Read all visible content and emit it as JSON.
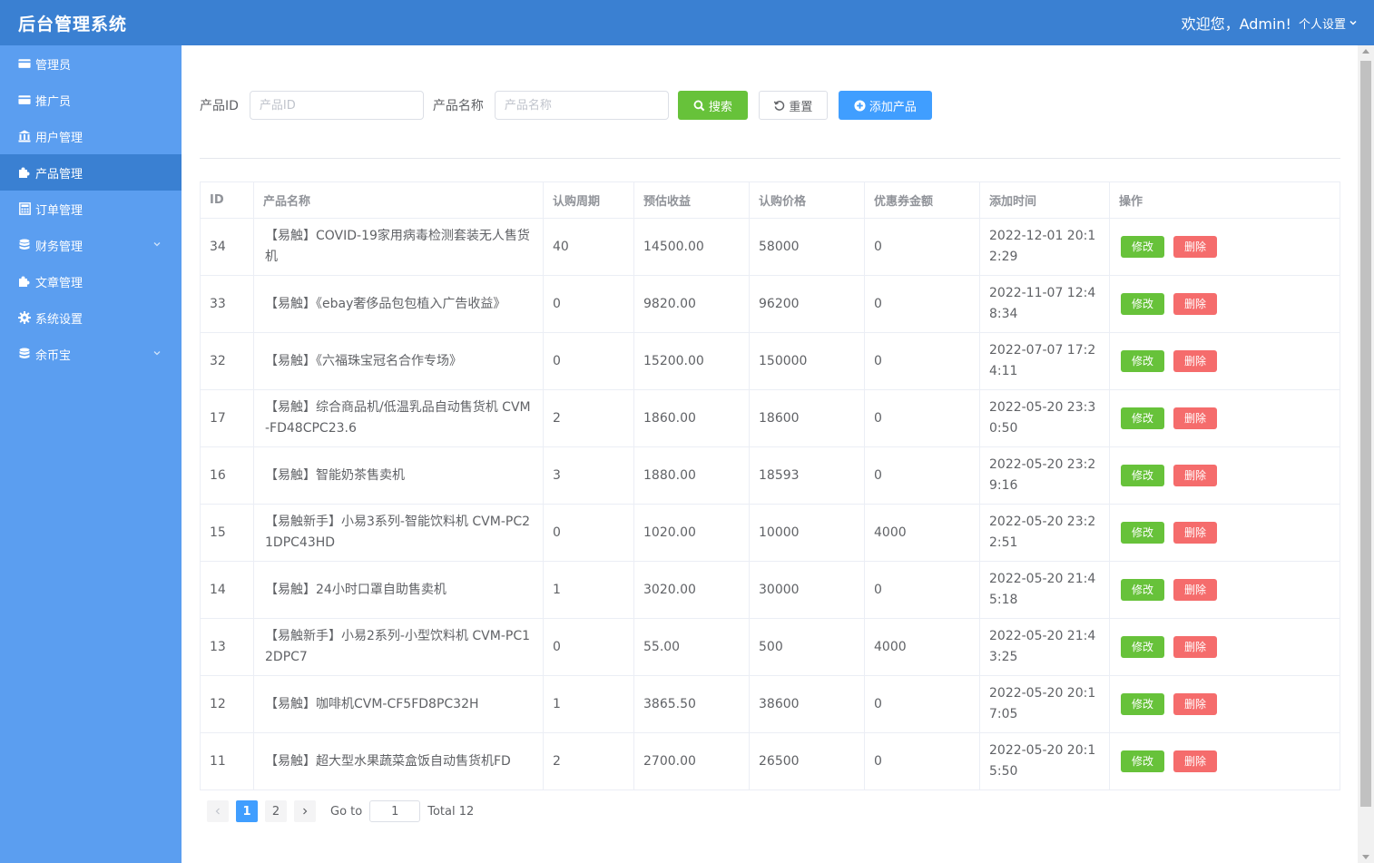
{
  "header": {
    "brand": "后台管理系统",
    "welcome": "欢迎您，Admin!",
    "settings": "个人设置"
  },
  "sidebar": {
    "items": [
      {
        "label": "管理员",
        "icon": "card-icon"
      },
      {
        "label": "推广员",
        "icon": "card-icon"
      },
      {
        "label": "用户管理",
        "icon": "bank-icon"
      },
      {
        "label": "产品管理",
        "icon": "puzzle-icon",
        "active": true
      },
      {
        "label": "订单管理",
        "icon": "calculator-icon"
      },
      {
        "label": "财务管理",
        "icon": "database-icon",
        "has_children": true
      },
      {
        "label": "文章管理",
        "icon": "puzzle-icon"
      },
      {
        "label": "系统设置",
        "icon": "gear-icon"
      },
      {
        "label": "余币宝",
        "icon": "database-icon",
        "has_children": true
      }
    ]
  },
  "filter": {
    "id_label": "产品ID",
    "id_placeholder": "产品ID",
    "name_label": "产品名称",
    "name_placeholder": "产品名称",
    "search_label": "搜索",
    "reset_label": "重置",
    "add_label": "添加产品"
  },
  "table": {
    "columns": [
      "ID",
      "产品名称",
      "认购周期",
      "预估收益",
      "认购价格",
      "优惠券金额",
      "添加时间",
      "操作"
    ],
    "edit_label": "修改",
    "delete_label": "删除",
    "rows": [
      {
        "id": "34",
        "name": "【易触】COVID-19家用病毒检测套装无人售货机",
        "period": "40",
        "income": "14500.00",
        "price": "58000",
        "coupon": "0",
        "time": "2022-12-01 20:12:29"
      },
      {
        "id": "33",
        "name": "【易触】《ebay奢侈品包包植入广告收益》",
        "period": "0",
        "income": "9820.00",
        "price": "96200",
        "coupon": "0",
        "time": "2022-11-07 12:48:34"
      },
      {
        "id": "32",
        "name": "【易触】《六福珠宝冠名合作专场》",
        "period": "0",
        "income": "15200.00",
        "price": "150000",
        "coupon": "0",
        "time": "2022-07-07 17:24:11"
      },
      {
        "id": "17",
        "name": "【易触】综合商品机/低温乳品自动售货机 CVM-FD48CPC23.6",
        "period": "2",
        "income": "1860.00",
        "price": "18600",
        "coupon": "0",
        "time": "2022-05-20 23:30:50"
      },
      {
        "id": "16",
        "name": "【易触】智能奶茶售卖机",
        "period": "3",
        "income": "1880.00",
        "price": "18593",
        "coupon": "0",
        "time": "2022-05-20 23:29:16"
      },
      {
        "id": "15",
        "name": "【易触新手】小易3系列-智能饮料机 CVM-PC21DPC43HD",
        "period": "0",
        "income": "1020.00",
        "price": "10000",
        "coupon": "4000",
        "time": "2022-05-20 23:22:51"
      },
      {
        "id": "14",
        "name": "【易触】24小时口罩自助售卖机",
        "period": "1",
        "income": "3020.00",
        "price": "30000",
        "coupon": "0",
        "time": "2022-05-20 21:45:18"
      },
      {
        "id": "13",
        "name": "【易触新手】小易2系列-小型饮料机 CVM-PC12DPC7",
        "period": "0",
        "income": "55.00",
        "price": "500",
        "coupon": "4000",
        "time": "2022-05-20 21:43:25"
      },
      {
        "id": "12",
        "name": "【易触】咖啡机CVM-CF5FD8PC32H",
        "period": "1",
        "income": "3865.50",
        "price": "38600",
        "coupon": "0",
        "time": "2022-05-20 20:17:05"
      },
      {
        "id": "11",
        "name": "【易触】超大型水果蔬菜盒饭自动售货机FD",
        "period": "2",
        "income": "2700.00",
        "price": "26500",
        "coupon": "0",
        "time": "2022-05-20 20:15:50"
      }
    ]
  },
  "pagination": {
    "pages": [
      "1",
      "2"
    ],
    "current": "1",
    "goto_label": "Go to",
    "goto_value": "1",
    "total": "Total 12"
  },
  "colors": {
    "header": "#3a80d2",
    "sidebar": "#5b9ef0",
    "success": "#67c23a",
    "danger": "#f56c6c",
    "primary": "#409eff"
  }
}
